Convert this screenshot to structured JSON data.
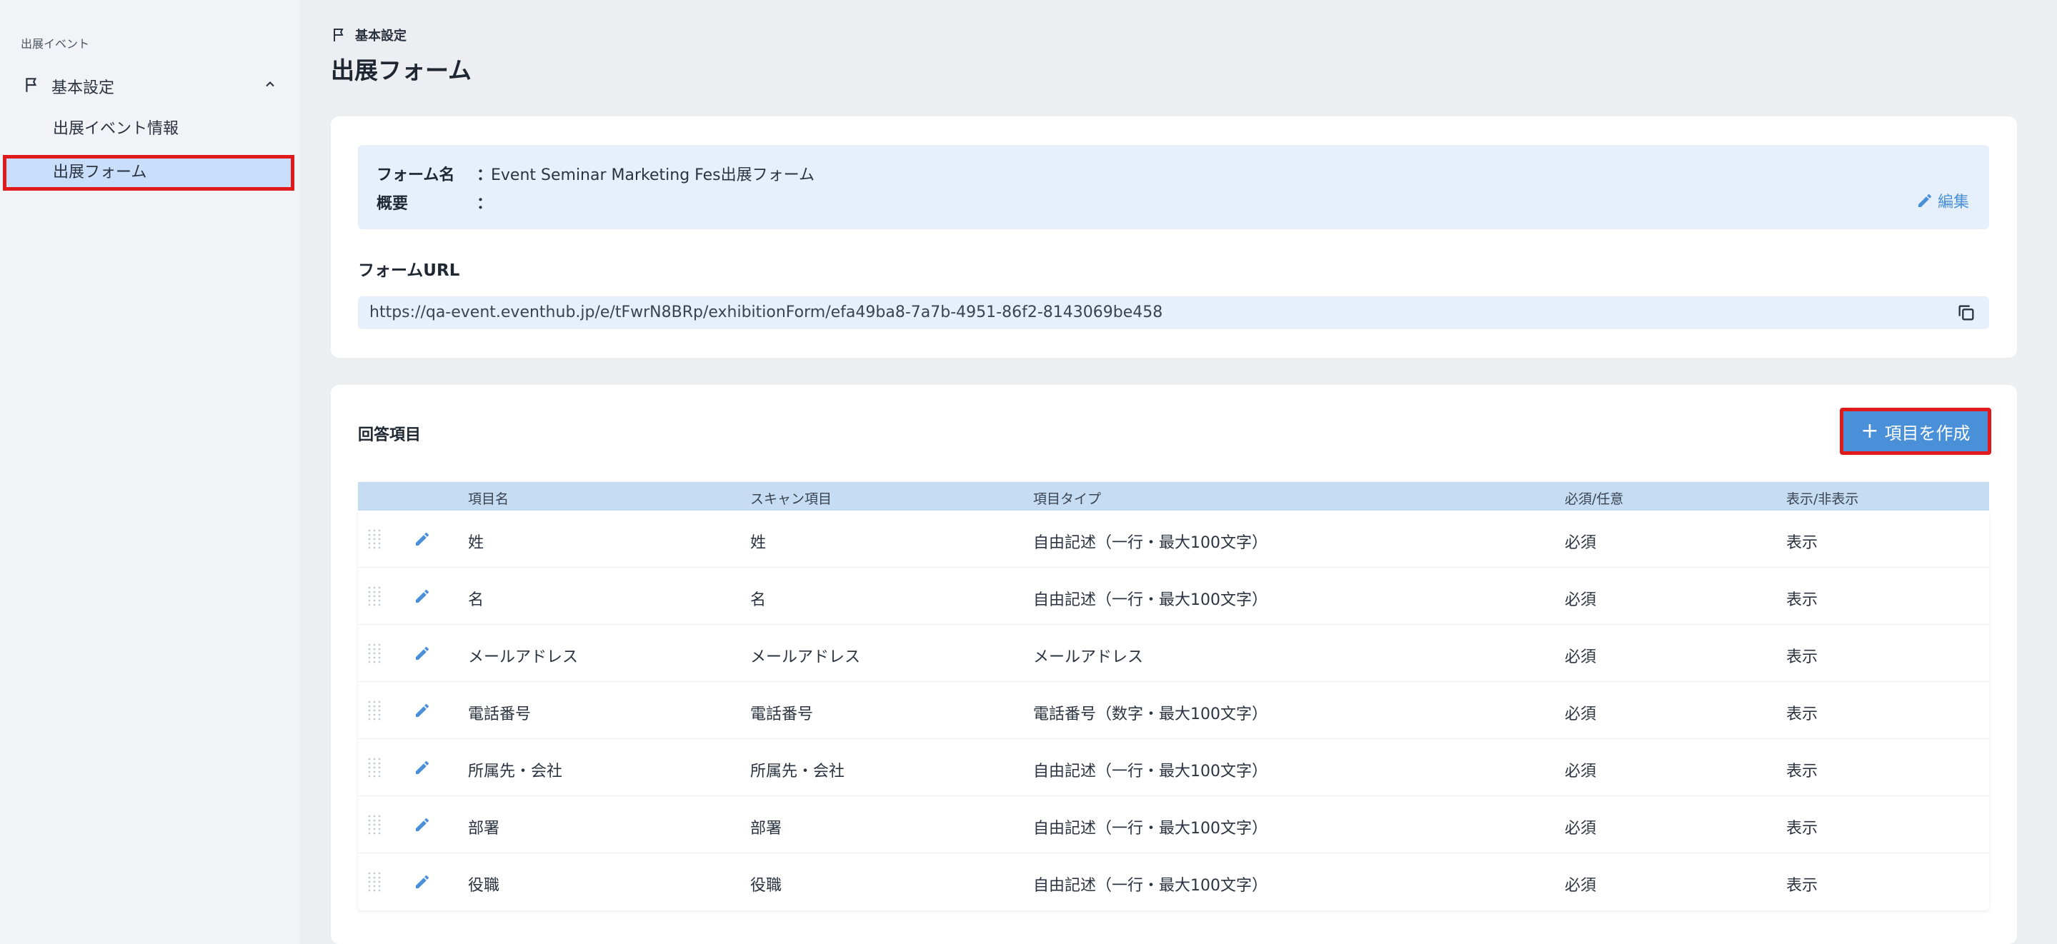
{
  "sidebar": {
    "section_label": "出展イベント",
    "group_label": "基本設定",
    "items": [
      {
        "label": "出展イベント情報"
      },
      {
        "label": "出展フォーム"
      }
    ]
  },
  "header": {
    "breadcrumb": "基本設定",
    "title": "出展フォーム"
  },
  "form_info": {
    "name_key": "フォーム名",
    "name_value": "Event Seminar Marketing Fes出展フォーム",
    "summary_key": "概要",
    "summary_value": "",
    "separator": "：",
    "edit_label": "編集"
  },
  "form_url": {
    "label": "フォームURL",
    "value": "https://qa-event.eventhub.jp/e/tFwrN8BRp/exhibitionForm/efa49ba8-7a7b-4951-86f2-8143069be458"
  },
  "answers": {
    "title": "回答項目",
    "create_label": "項目を作成",
    "columns": [
      "項目名",
      "スキャン項目",
      "項目タイプ",
      "必須/任意",
      "表示/非表示"
    ],
    "rows": [
      {
        "name": "姓",
        "scan": "姓",
        "type": "自由記述（一行・最大100文字）",
        "required": "必須",
        "visible": "表示"
      },
      {
        "name": "名",
        "scan": "名",
        "type": "自由記述（一行・最大100文字）",
        "required": "必須",
        "visible": "表示"
      },
      {
        "name": "メールアドレス",
        "scan": "メールアドレス",
        "type": "メールアドレス",
        "required": "必須",
        "visible": "表示"
      },
      {
        "name": "電話番号",
        "scan": "電話番号",
        "type": "電話番号（数字・最大100文字）",
        "required": "必須",
        "visible": "表示"
      },
      {
        "name": "所属先・会社",
        "scan": "所属先・会社",
        "type": "自由記述（一行・最大100文字）",
        "required": "必須",
        "visible": "表示"
      },
      {
        "name": "部署",
        "scan": "部署",
        "type": "自由記述（一行・最大100文字）",
        "required": "必須",
        "visible": "表示"
      },
      {
        "name": "役職",
        "scan": "役職",
        "type": "自由記述（一行・最大100文字）",
        "required": "必須",
        "visible": "表示"
      }
    ]
  },
  "colors": {
    "accent": "#4a90d9",
    "highlight_border": "#e01a1a",
    "selected_bg": "#c9defa"
  }
}
